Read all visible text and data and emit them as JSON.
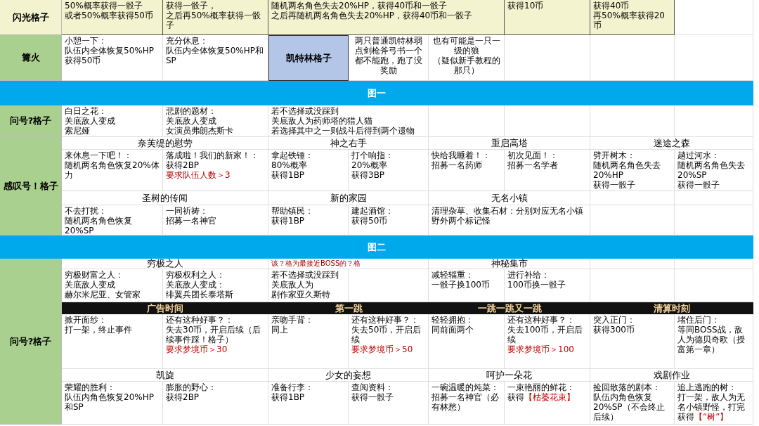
{
  "sections": [
    {
      "kind": "group",
      "label": "闪光格子",
      "color": "#f3f3cf",
      "rows": [
        {
          "kind": "content",
          "color": "#f3f3cf",
          "cells": [
            {
              "kind": "single",
              "lines": [
                "50%概率获得一骰子",
                "或者50%概率获得50币"
              ]
            },
            {
              "kind": "single",
              "lines": [
                "获得一骰子，",
                "之后再50%概率获得一骰子"
              ]
            },
            {
              "kind": "triple",
              "lines": [
                "随机两名角色失去20%HP，获得40币和一骰子",
                "之后再随机两名角色失去20%HP，获得40币和一骰子"
              ]
            },
            {
              "kind": "single",
              "lines": [
                "获得10币"
              ]
            },
            {
              "kind": "single",
              "lines": [
                "获得40币",
                "再50%概率获得20币"
              ]
            }
          ]
        }
      ]
    },
    {
      "kind": "group",
      "label": "篝火",
      "color": "#a9d08e",
      "rows": [
        {
          "kind": "content",
          "cells": [
            {
              "kind": "single",
              "lines": [
                "小憩一下：",
                "队伍内全体恢复50%HP",
                "获得50币"
              ]
            },
            {
              "kind": "single",
              "lines": [
                "充分休息：",
                "队伍内全体恢复50%HP和SP"
              ]
            },
            {
              "kind": "tile",
              "lines": [
                "凯特林格子"
              ]
            },
            {
              "kind": "note",
              "lines": [
                "两只普通凯特林弱点剑枪斧弓书一个都不能跑，跑了没奖励"
              ]
            },
            {
              "kind": "note",
              "lines": [
                "也有可能是一只一级的狼",
                "（疑似新手教程的那只）"
              ]
            }
          ]
        }
      ]
    },
    {
      "kind": "band",
      "title": "图一"
    },
    {
      "kind": "group",
      "label": "问号?格子",
      "color": "#a9d08e",
      "rows": [
        {
          "kind": "content",
          "cells": [
            {
              "kind": "single",
              "lines": [
                "白日之花：",
                "关底敌人变成",
                "索尼娅"
              ]
            },
            {
              "kind": "single",
              "lines": [
                "悲剧的题材：",
                "关底敌人变成",
                "女演员弗朗杰斯卡"
              ]
            },
            {
              "kind": "pair",
              "lines": [
                "若不选择或没踩到",
                "关底敌人为药师塔的猎人猫",
                "若选择其中之一则战斗后得到两个遗物"
              ]
            }
          ]
        }
      ]
    },
    {
      "kind": "group",
      "label": "感叹号！格子",
      "color": "#a9d08e",
      "rows": [
        {
          "kind": "header",
          "cells": [
            {
              "kind": "pair",
              "lines": [
                "奈芙缇的慰劳"
              ]
            },
            {
              "kind": "pair",
              "lines": [
                "神之右手"
              ]
            },
            {
              "kind": "pair",
              "lines": [
                "重启高塔"
              ]
            },
            {
              "kind": "pair",
              "lines": [
                "迷途之森"
              ]
            }
          ]
        },
        {
          "kind": "content",
          "cells": [
            {
              "kind": "single",
              "lines": [
                "来休息一下吧！：",
                "随机两名角色恢复20%体力"
              ]
            },
            {
              "kind": "single",
              "lines": [
                "落成啦！我们的新家！：",
                "获得2BP"
              ],
              "requirement": "要求队伍人数＞3"
            },
            {
              "kind": "single",
              "lines": [
                "拿起铁锤：",
                "80%概率",
                "获得1BP"
              ]
            },
            {
              "kind": "single",
              "lines": [
                "打个响指：",
                "20%概率",
                "获得3BP"
              ]
            },
            {
              "kind": "single",
              "lines": [
                "快给我睡着！：",
                "招募一名药师"
              ]
            },
            {
              "kind": "single",
              "lines": [
                "初次见面！：",
                "招募一名学者"
              ]
            },
            {
              "kind": "single",
              "lines": [
                "劈开树木：",
                "随机两名角色失去20%HP",
                "获得一骰子"
              ]
            },
            {
              "kind": "single",
              "lines": [
                "趟过河水：",
                "随机两名角色失去20%SP",
                "获得一骰子"
              ]
            }
          ]
        },
        {
          "kind": "header",
          "cells": [
            {
              "kind": "pair",
              "lines": [
                "圣树的传闻"
              ]
            },
            {
              "kind": "pair",
              "lines": [
                "新的家园"
              ]
            },
            {
              "kind": "pair",
              "lines": [
                "无名小镇"
              ]
            }
          ]
        },
        {
          "kind": "content",
          "cells": [
            {
              "kind": "single",
              "lines": [
                "不去打扰：",
                "随机两名角色恢复20%SP"
              ]
            },
            {
              "kind": "single",
              "lines": [
                "一同祈祷：",
                "招募一名神官"
              ]
            },
            {
              "kind": "single",
              "lines": [
                "帮助镇民：",
                "获得1BP"
              ]
            },
            {
              "kind": "single",
              "lines": [
                "建起酒馆：",
                "获得50币"
              ]
            },
            {
              "kind": "pair",
              "lines": [
                "清理杂草、收集石材：分别对应无名小镇野外两个标记怪"
              ]
            }
          ]
        }
      ]
    },
    {
      "kind": "band",
      "title": "图二"
    },
    {
      "kind": "group",
      "label": "问号?格子",
      "color": "#a9d08e",
      "rows": [
        {
          "kind": "header",
          "cells": [
            {
              "kind": "pair",
              "lines": [
                "穷极之人"
              ]
            },
            {
              "kind": "caption",
              "lines": [
                "该？格为最接近BOSS的？格"
              ]
            },
            {
              "kind": "pair",
              "lines": [
                "神秘集市"
              ]
            }
          ]
        },
        {
          "kind": "content",
          "cells": [
            {
              "kind": "single",
              "lines": [
                "穷极财富之人：",
                "关底敌人变成",
                "赫尔米尼亚、女管家"
              ]
            },
            {
              "kind": "single",
              "lines": [
                "穷极权利之人：",
                "关底敌人变成：",
                "绯翼兵团长泰塔斯"
              ]
            },
            {
              "kind": "single",
              "lines": [
                "若不选择或没踩到",
                "关底敌人为",
                "剧作家亚久斯特"
              ]
            },
            {
              "kind": "blank"
            },
            {
              "kind": "single",
              "lines": [
                "减轻辎重：",
                "一骰子换100币"
              ]
            },
            {
              "kind": "single",
              "lines": [
                "进行补给：",
                "100币换一骰子"
              ]
            }
          ]
        },
        {
          "kind": "banner",
          "cells": [
            {
              "kind": "pair",
              "lines": [
                "广告时间"
              ]
            },
            {
              "kind": "pair",
              "lines": [
                "第一跳"
              ]
            },
            {
              "kind": "pair",
              "lines": [
                "一跳一跳又一跳"
              ]
            },
            {
              "kind": "pair",
              "lines": [
                "清算时刻"
              ]
            }
          ]
        },
        {
          "kind": "content",
          "cells": [
            {
              "kind": "single",
              "lines": [
                "掀开面纱：",
                "打一架，终止事件"
              ]
            },
            {
              "kind": "single",
              "lines": [
                "还有这种好事？：",
                "失去30币，开启后续（后续事件踩！格子）"
              ],
              "requirement": "要求梦境币＞30"
            },
            {
              "kind": "single",
              "lines": [
                "亲吻手背：",
                "同上"
              ]
            },
            {
              "kind": "single",
              "lines": [
                "还有这种好事？：",
                "失去50币，开启后续"
              ],
              "requirement": "要求梦境币＞50"
            },
            {
              "kind": "single",
              "lines": [
                "轻轻拥抱：",
                "同前面两个"
              ]
            },
            {
              "kind": "single",
              "lines": [
                "还有这种好事？：",
                "失去100币，开启后续"
              ],
              "requirement": "要求梦境币＞100"
            },
            {
              "kind": "single",
              "lines": [
                "突入正门：",
                "获得300币"
              ]
            },
            {
              "kind": "single",
              "lines": [
                "堵住后门：",
                "等同BOSS战，敌人为德贝奇欧（授富第一章）"
              ]
            }
          ]
        },
        {
          "kind": "header",
          "cells": [
            {
              "kind": "pair",
              "lines": [
                "凯旋"
              ]
            },
            {
              "kind": "pair",
              "lines": [
                "少女的妄想"
              ]
            },
            {
              "kind": "pair",
              "lines": [
                "呵护一朵花"
              ]
            },
            {
              "kind": "pair",
              "lines": [
                "戏剧作业"
              ]
            }
          ]
        },
        {
          "kind": "content",
          "cells": [
            {
              "kind": "single",
              "lines": [
                "荣耀的胜利：",
                "队伍内角色恢复20%HP和SP"
              ]
            },
            {
              "kind": "single",
              "lines": [
                "膨胀的野心：",
                "获得2BP"
              ]
            },
            {
              "kind": "single",
              "lines": [
                "准备行李：",
                "获得1BP"
              ]
            },
            {
              "kind": "single",
              "lines": [
                "查阅资料：",
                "获得一骰子"
              ]
            },
            {
              "kind": "single",
              "lines": [
                "一碗温暖的炖菜：",
                "招募一名神官（必有林愁）"
              ]
            },
            {
              "kind": "single",
              "lines": [
                "一束艳丽的鲜花：",
                "获得"
              ],
              "highlight": "【枯萎花束】"
            },
            {
              "kind": "single",
              "lines": [
                "捡回散落的剧本：",
                "队伍内角色恢复20%SP（不会终止后续）"
              ]
            },
            {
              "kind": "single",
              "lines": [
                "追上逃跑的树：",
                "打一架，敌人为无名小镇野怪，打完获得"
              ],
              "highlight": "【“树”】"
            }
          ]
        }
      ]
    }
  ]
}
